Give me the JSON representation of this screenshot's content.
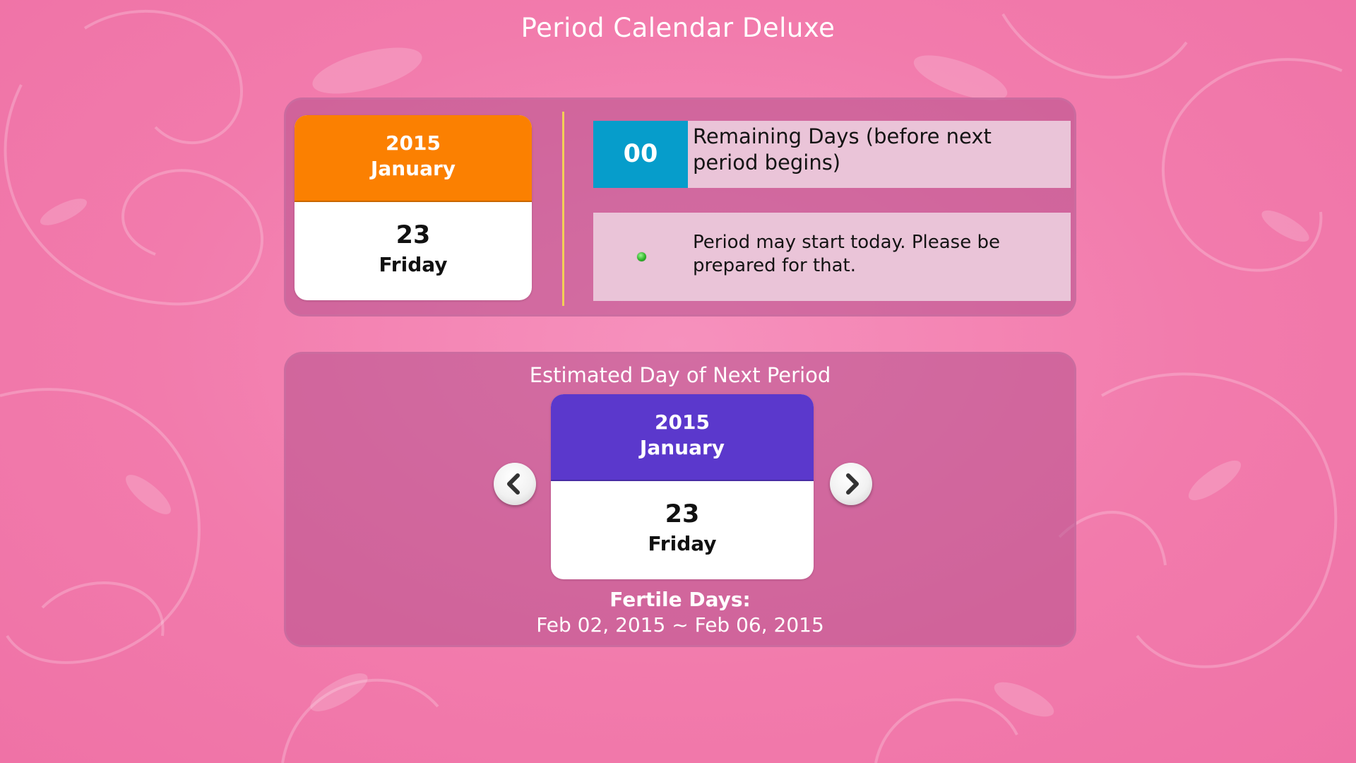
{
  "app": {
    "title": "Period Calendar Deluxe"
  },
  "today": {
    "year": "2015",
    "month": "January",
    "day": "23",
    "weekday": "Friday",
    "header_color": "#fb8001"
  },
  "remaining": {
    "count": "00",
    "label": "Remaining Days (before next period begins)",
    "count_color": "#069dcb"
  },
  "message": {
    "status_icon": "green-dot-icon",
    "text": "Period may start today. Please be prepared for that."
  },
  "next_period": {
    "title": "Estimated Day of Next Period",
    "year": "2015",
    "month": "January",
    "day": "23",
    "weekday": "Friday",
    "header_color": "#5b38cc",
    "prev_icon": "chevron-left-icon",
    "next_icon": "chevron-right-icon"
  },
  "fertile": {
    "title": "Fertile Days:",
    "range": "Feb 02, 2015 ~ Feb 06, 2015"
  },
  "theme": {
    "background": "#f27bac",
    "panel": "#c96a9b",
    "message_bg": "#eac4d8",
    "divider": "#f2cf55"
  }
}
